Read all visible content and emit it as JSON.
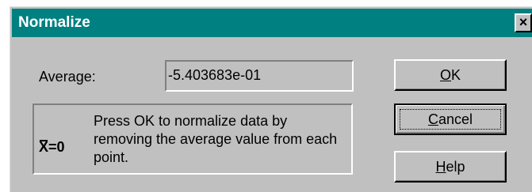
{
  "window": {
    "title": "Normalize",
    "close_symbol": "×",
    "close_icon": "close-icon"
  },
  "average": {
    "label": "Average:",
    "value": "-5.403683e-01"
  },
  "info": {
    "formula_var": "X",
    "formula_rest": "=0",
    "text": "Press OK to normalize data by removing the average value from each point."
  },
  "buttons": {
    "ok": {
      "mnemonic": "O",
      "rest": "K"
    },
    "cancel": {
      "mnemonic": "C",
      "rest": "ancel"
    },
    "help": {
      "mnemonic": "H",
      "rest": "elp"
    }
  },
  "colors": {
    "titlebar": "#008080",
    "dialog_face": "#c0c0c0"
  }
}
